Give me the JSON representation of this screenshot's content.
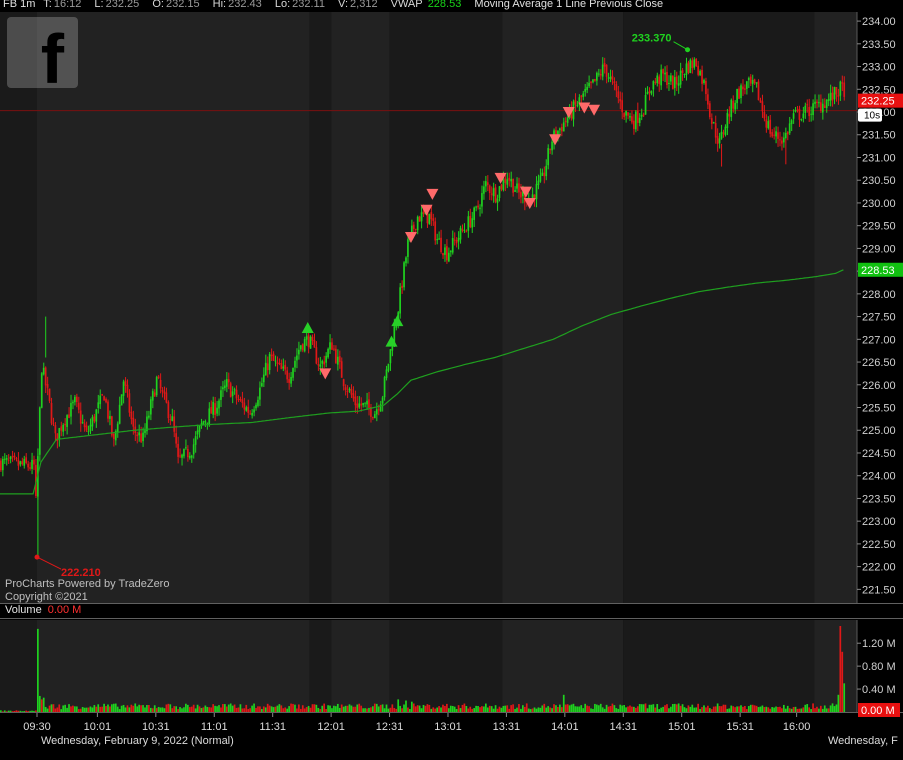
{
  "header": {
    "symbol_interval": "FB 1m",
    "time_label": "T:",
    "time": "16:12",
    "last_label": "L:",
    "last": "232.25",
    "open_label": "O:",
    "open": "232.15",
    "high_label": "Hi:",
    "high": "232.43",
    "low_label": "Lo:",
    "low": "232.11",
    "volume_label": "V:",
    "volume": "2,312",
    "vwap_label": "VWAP",
    "vwap": "228.53",
    "studies": "Moving Average 1 Line Previous Close"
  },
  "credit": {
    "line1": "ProCharts Powered by TradeZero",
    "line2": "Copyright ©2021"
  },
  "volume_panel": {
    "title": "Volume",
    "value": "0.00 M"
  },
  "footer": {
    "date_left": "Wednesday, February 9, 2022 (Normal)",
    "date_right": "Wednesday, F"
  },
  "colors": {
    "up": "#1fd21f",
    "down": "#e01818",
    "vwap_line": "#1fa01f",
    "session_shade": "#222222",
    "alt_shade": "#1a1a1a",
    "prev_close": "#7a1010",
    "price_label_bg": "#e81010",
    "vwap_label_bg": "#10c010",
    "marker_up": "#28d028",
    "marker_down": "#ff6a6a"
  },
  "chart_data": [
    {
      "type": "candlestick",
      "symbol": "FB",
      "interval": "1m",
      "ylim": [
        221.2,
        234.2
      ],
      "y_ticks": [
        "221.50",
        "222.00",
        "222.50",
        "223.00",
        "223.50",
        "224.00",
        "224.50",
        "225.00",
        "225.50",
        "226.00",
        "226.50",
        "227.00",
        "227.50",
        "228.00",
        "228.50",
        "229.00",
        "229.50",
        "230.00",
        "230.50",
        "231.00",
        "231.50",
        "232.00",
        "232.50",
        "233.00",
        "233.50",
        "234.00"
      ],
      "x_ticks": [
        "09:30",
        "10:01",
        "10:31",
        "11:01",
        "11:31",
        "12:01",
        "12:31",
        "13:01",
        "13:31",
        "14:01",
        "14:31",
        "15:01",
        "15:31",
        "16:00"
      ],
      "x_tick_minutes": [
        570,
        601,
        631,
        661,
        691,
        721,
        751,
        781,
        811,
        841,
        871,
        901,
        931,
        960
      ],
      "x_range_minutes": [
        551,
        991
      ],
      "price_keypoints": [
        [
          551,
          224.3
        ],
        [
          569,
          224.2
        ],
        [
          570,
          223.4
        ],
        [
          573,
          226.4
        ],
        [
          576,
          225.8
        ],
        [
          580,
          224.8
        ],
        [
          584,
          225.2
        ],
        [
          590,
          225.6
        ],
        [
          596,
          224.9
        ],
        [
          605,
          225.8
        ],
        [
          610,
          224.7
        ],
        [
          615,
          226.1
        ],
        [
          620,
          225.0
        ],
        [
          625,
          224.8
        ],
        [
          632,
          226.1
        ],
        [
          640,
          225.2
        ],
        [
          643,
          224.3
        ],
        [
          650,
          224.6
        ],
        [
          656,
          225.2
        ],
        [
          662,
          225.5
        ],
        [
          668,
          226.0
        ],
        [
          675,
          225.6
        ],
        [
          680,
          225.4
        ],
        [
          685,
          225.9
        ],
        [
          690,
          226.6
        ],
        [
          696,
          226.3
        ],
        [
          700,
          226.2
        ],
        [
          706,
          226.9
        ],
        [
          710,
          227.0
        ],
        [
          716,
          226.4
        ],
        [
          722,
          226.9
        ],
        [
          728,
          226.1
        ],
        [
          734,
          225.6
        ],
        [
          740,
          225.5
        ],
        [
          744,
          225.4
        ],
        [
          748,
          225.8
        ],
        [
          751,
          226.5
        ],
        [
          756,
          227.7
        ],
        [
          761,
          229.1
        ],
        [
          766,
          229.7
        ],
        [
          772,
          229.7
        ],
        [
          776,
          229.2
        ],
        [
          781,
          228.9
        ],
        [
          786,
          229.2
        ],
        [
          791,
          229.5
        ],
        [
          796,
          229.8
        ],
        [
          801,
          230.4
        ],
        [
          806,
          230.2
        ],
        [
          812,
          230.6
        ],
        [
          818,
          230.2
        ],
        [
          824,
          230.1
        ],
        [
          830,
          230.5
        ],
        [
          835,
          231.4
        ],
        [
          840,
          231.7
        ],
        [
          845,
          232.0
        ],
        [
          850,
          232.3
        ],
        [
          856,
          232.6
        ],
        [
          862,
          233.0
        ],
        [
          868,
          232.4
        ],
        [
          872,
          232.0
        ],
        [
          877,
          231.8
        ],
        [
          882,
          232.1
        ],
        [
          886,
          232.6
        ],
        [
          892,
          232.8
        ],
        [
          898,
          232.6
        ],
        [
          904,
          233.0
        ],
        [
          909,
          233.1
        ],
        [
          914,
          232.5
        ],
        [
          917,
          231.8
        ],
        [
          921,
          231.3
        ],
        [
          925,
          231.9
        ],
        [
          930,
          232.4
        ],
        [
          935,
          232.6
        ],
        [
          940,
          232.5
        ],
        [
          944,
          231.9
        ],
        [
          948,
          231.5
        ],
        [
          954,
          231.4
        ],
        [
          959,
          231.9
        ],
        [
          965,
          232.0
        ],
        [
          970,
          232.1
        ],
        [
          978,
          232.3
        ],
        [
          983,
          232.5
        ]
      ],
      "vwap_keypoints": [
        [
          551,
          223.6
        ],
        [
          568,
          223.6
        ],
        [
          572,
          224.3
        ],
        [
          580,
          224.8
        ],
        [
          600,
          224.9
        ],
        [
          620,
          225.0
        ],
        [
          640,
          225.07
        ],
        [
          660,
          225.13
        ],
        [
          680,
          225.17
        ],
        [
          700,
          225.28
        ],
        [
          720,
          225.38
        ],
        [
          735,
          225.42
        ],
        [
          748,
          225.55
        ],
        [
          755,
          225.8
        ],
        [
          762,
          226.1
        ],
        [
          775,
          226.28
        ],
        [
          790,
          226.45
        ],
        [
          805,
          226.6
        ],
        [
          820,
          226.8
        ],
        [
          835,
          227.0
        ],
        [
          850,
          227.3
        ],
        [
          865,
          227.55
        ],
        [
          880,
          227.73
        ],
        [
          895,
          227.9
        ],
        [
          910,
          228.05
        ],
        [
          925,
          228.15
        ],
        [
          940,
          228.24
        ],
        [
          955,
          228.3
        ],
        [
          970,
          228.38
        ],
        [
          980,
          228.45
        ],
        [
          984,
          228.53
        ]
      ],
      "shaded_sessions_minutes": [
        [
          570,
          710
        ],
        [
          721,
          751
        ],
        [
          809,
          871
        ],
        [
          969,
          991
        ]
      ],
      "dark_sessions_minutes": [
        [
          551,
          570
        ],
        [
          710,
          721
        ],
        [
          751,
          809
        ],
        [
          871,
          969
        ]
      ],
      "previous_close": 232.03,
      "current_price": "232.25",
      "current_vwap": "228.53",
      "countdown": "10s",
      "annotations": [
        {
          "text": "233.370",
          "minute": 904,
          "price": 233.37,
          "type": "high"
        },
        {
          "text": "222.210",
          "minute": 570,
          "price": 222.21,
          "type": "low"
        }
      ],
      "signals": [
        {
          "minute": 709,
          "price": 227.25,
          "dir": "up"
        },
        {
          "minute": 752,
          "price": 226.95,
          "dir": "up"
        },
        {
          "minute": 755,
          "price": 227.4,
          "dir": "up"
        },
        {
          "minute": 718,
          "price": 226.25,
          "dir": "down"
        },
        {
          "minute": 762,
          "price": 229.25,
          "dir": "down"
        },
        {
          "minute": 770,
          "price": 229.85,
          "dir": "down"
        },
        {
          "minute": 773,
          "price": 230.2,
          "dir": "down"
        },
        {
          "minute": 808,
          "price": 230.55,
          "dir": "down"
        },
        {
          "minute": 821,
          "price": 230.25,
          "dir": "down"
        },
        {
          "minute": 823,
          "price": 230.0,
          "dir": "down"
        },
        {
          "minute": 836,
          "price": 231.4,
          "dir": "down"
        },
        {
          "minute": 843,
          "price": 232.0,
          "dir": "down"
        },
        {
          "minute": 851,
          "price": 232.1,
          "dir": "down"
        },
        {
          "minute": 856,
          "price": 232.05,
          "dir": "down"
        }
      ]
    },
    {
      "type": "bar",
      "name": "Volume",
      "ylim": [
        0,
        1.5
      ],
      "y_ticks": [
        "1.20 M",
        "0.80 M",
        "0.40 M"
      ],
      "current_value": "0.00 M",
      "typical_volume_m": 0.1,
      "notable_bars": [
        {
          "minute": 570,
          "value_m": 1.45,
          "dir": "up"
        },
        {
          "minute": 571,
          "value_m": 0.28,
          "dir": "up"
        },
        {
          "minute": 572,
          "value_m": 0.22,
          "dir": "down"
        },
        {
          "minute": 573,
          "value_m": 0.25,
          "dir": "up"
        },
        {
          "minute": 755,
          "value_m": 0.22,
          "dir": "up"
        },
        {
          "minute": 759,
          "value_m": 0.2,
          "dir": "up"
        },
        {
          "minute": 762,
          "value_m": 0.18,
          "dir": "up"
        },
        {
          "minute": 840,
          "value_m": 0.3,
          "dir": "up"
        },
        {
          "minute": 978,
          "value_m": 0.15,
          "dir": "up"
        },
        {
          "minute": 981,
          "value_m": 0.3,
          "dir": "up"
        },
        {
          "minute": 982,
          "value_m": 1.55,
          "dir": "down"
        },
        {
          "minute": 983,
          "value_m": 1.05,
          "dir": "down"
        },
        {
          "minute": 984,
          "value_m": 0.5,
          "dir": "up"
        }
      ]
    }
  ]
}
